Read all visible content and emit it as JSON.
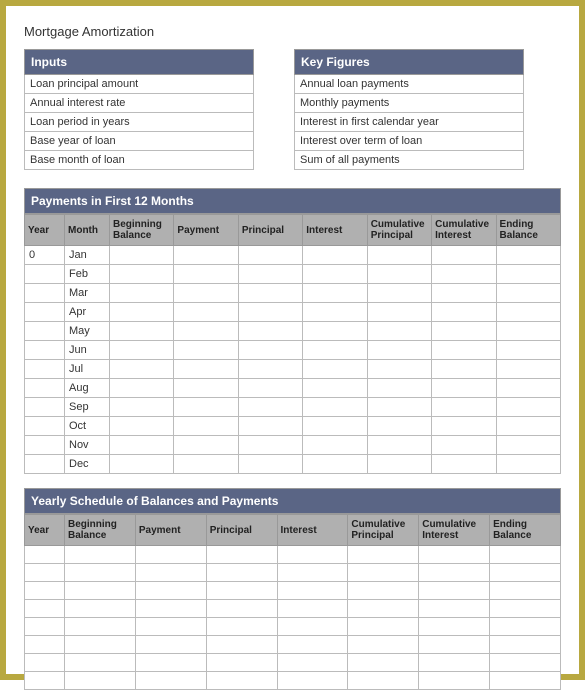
{
  "title": "Mortgage Amortization",
  "inputs": {
    "header": "Inputs",
    "rows": [
      "Loan principal amount",
      "Annual interest rate",
      "Loan period in years",
      "Base year of loan",
      "Base month of loan"
    ]
  },
  "keyFigures": {
    "header": "Key Figures",
    "rows": [
      "Annual loan payments",
      "Monthly payments",
      "Interest in first calendar year",
      "Interest over term of loan",
      "Sum of all payments"
    ]
  },
  "monthly": {
    "header": "Payments in First 12 Months",
    "columns": [
      "Year",
      "Month",
      "Beginning Balance",
      "Payment",
      "Principal",
      "Interest",
      "Cumulative Principal",
      "Cumulative Interest",
      "Ending Balance"
    ],
    "rows": [
      {
        "year": "0",
        "month": "Jan"
      },
      {
        "year": "",
        "month": "Feb"
      },
      {
        "year": "",
        "month": "Mar"
      },
      {
        "year": "",
        "month": "Apr"
      },
      {
        "year": "",
        "month": "May"
      },
      {
        "year": "",
        "month": "Jun"
      },
      {
        "year": "",
        "month": "Jul"
      },
      {
        "year": "",
        "month": "Aug"
      },
      {
        "year": "",
        "month": "Sep"
      },
      {
        "year": "",
        "month": "Oct"
      },
      {
        "year": "",
        "month": "Nov"
      },
      {
        "year": "",
        "month": "Dec"
      }
    ]
  },
  "yearly": {
    "header": "Yearly Schedule of Balances and Payments",
    "columns": [
      "Year",
      "Beginning Balance",
      "Payment",
      "Principal",
      "Interest",
      "Cumulative Principal",
      "Cumulative Interest",
      "Ending Balance"
    ],
    "rowCount": 8
  }
}
